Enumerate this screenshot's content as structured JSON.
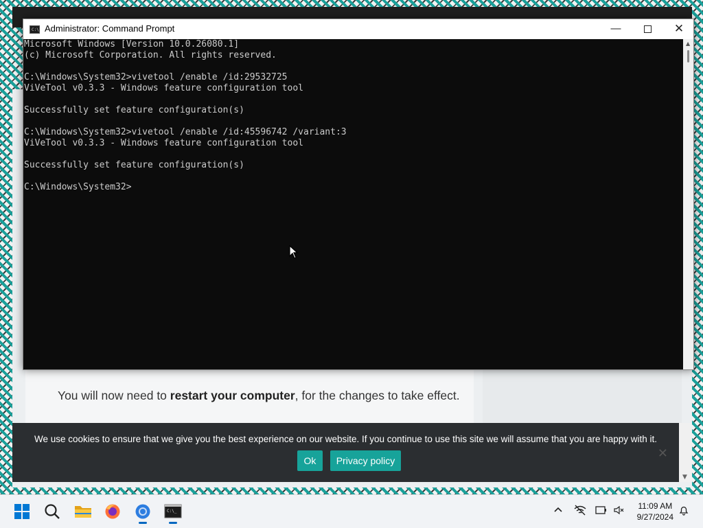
{
  "console_window": {
    "title": "Administrator: Command Prompt",
    "app_icon_text": "C:\\",
    "controls": {
      "minimize": "—",
      "close": "✕"
    },
    "lines": [
      "Microsoft Windows [Version 10.0.26080.1]",
      "(c) Microsoft Corporation. All rights reserved.",
      "",
      "C:\\Windows\\System32>vivetool /enable /id:29532725",
      "ViVeTool v0.3.3 - Windows feature configuration tool",
      "",
      "Successfully set feature configuration(s)",
      "",
      "C:\\Windows\\System32>vivetool /enable /id:45596742 /variant:3",
      "ViVeTool v0.3.3 - Windows feature configuration tool",
      "",
      "Successfully set feature configuration(s)",
      "",
      "C:\\Windows\\System32>"
    ]
  },
  "article": {
    "text_before": "You will now need to ",
    "bold": "restart your computer",
    "text_after": ", for the changes to take effect."
  },
  "cookie_banner": {
    "message": "We use cookies to ensure that we give you the best experience on our website. If you continue to use this site we will assume that you are happy with it.",
    "ok_label": "Ok",
    "privacy_label": "Privacy policy",
    "close_label": "✕"
  },
  "taskbar": {
    "time": "11:09 AM",
    "date": "9/27/2024",
    "icons": [
      "start-icon",
      "search-icon",
      "file-explorer-icon",
      "firefox-icon",
      "chrome-icon",
      "terminal-icon"
    ],
    "tray_icons": [
      "chevron-up-icon",
      "network-off-icon",
      "battery-icon",
      "volume-mute-icon",
      "notifications-icon"
    ]
  },
  "colors": {
    "console_bg": "#0c0c0c",
    "console_text": "#cccccc",
    "cookie_bg": "#2b2e31",
    "cookie_button": "#17a39a",
    "taskbar_bg": "#f1f3f6",
    "accent": "#0067c0"
  }
}
